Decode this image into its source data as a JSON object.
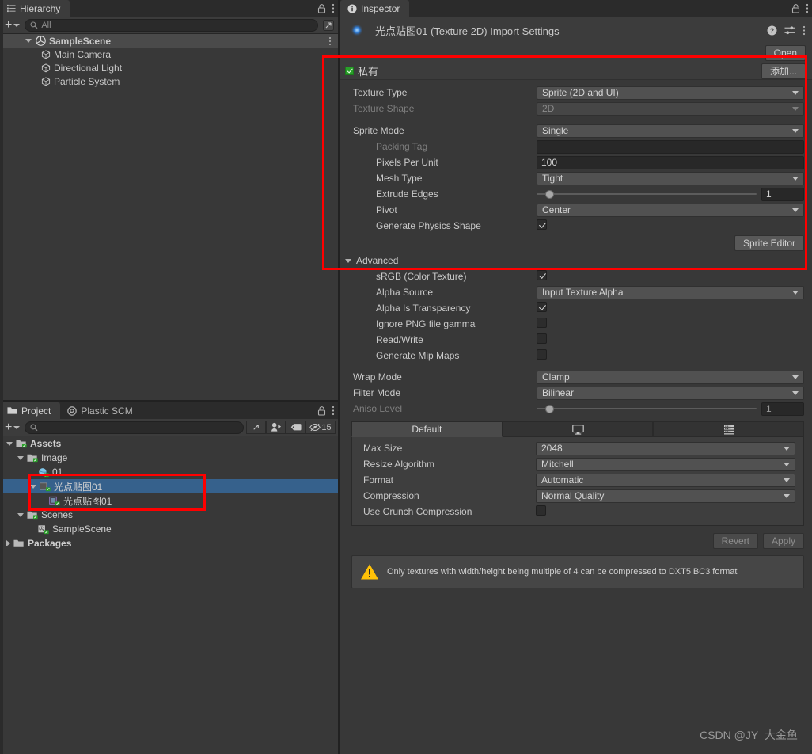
{
  "hierarchy": {
    "tab_label": "Hierarchy",
    "tab_icon": "hierarchy-icon",
    "lock_icon": "lock-icon",
    "menu_icon": "kebab-menu-icon",
    "add_label": "+",
    "search_placeholder": "All",
    "search_icon": "search-icon",
    "expand_icon": "expand-icon",
    "items": [
      {
        "label": "SampleScene",
        "depth": 0,
        "icon": "unity-scene-icon",
        "expanded": true,
        "has_menu": true
      },
      {
        "label": "Main Camera",
        "depth": 1,
        "icon": "gameobject-cube-icon",
        "expanded": null,
        "has_menu": false
      },
      {
        "label": "Directional Light",
        "depth": 1,
        "icon": "gameobject-cube-icon",
        "expanded": null,
        "has_menu": false
      },
      {
        "label": "Particle System",
        "depth": 1,
        "icon": "gameobject-cube-icon",
        "expanded": null,
        "has_menu": false
      }
    ]
  },
  "project": {
    "tabs": [
      {
        "label": "Project",
        "icon": "folder-icon",
        "active": true
      },
      {
        "label": "Plastic SCM",
        "icon": "plastic-scm-icon",
        "active": false
      }
    ],
    "lock_icon": "lock-icon",
    "menu_icon": "kebab-menu-icon",
    "add_label": "+",
    "search_placeholder": "",
    "search_icon": "search-icon",
    "tool_icons": [
      "expand-icon",
      "avatar-filter-icon",
      "label-tag-icon",
      "hidden-eye-icon"
    ],
    "visible_count": "15",
    "items": [
      {
        "label": "Assets",
        "depth": 0,
        "icon": "folder-assets-icon",
        "expanded": true,
        "bold": true,
        "selected": false
      },
      {
        "label": "Image",
        "depth": 1,
        "icon": "folder-assets-icon",
        "expanded": true,
        "bold": false,
        "selected": false
      },
      {
        "label": "01",
        "depth": 2,
        "icon": "sphere-asset-icon",
        "expanded": null,
        "bold": false,
        "selected": false
      },
      {
        "label": "光点贴图01",
        "depth": 2,
        "icon": "texture-asset-icon",
        "expanded": true,
        "bold": false,
        "selected": true
      },
      {
        "label": "光点贴图01",
        "depth": 3,
        "icon": "sprite-asset-icon",
        "expanded": null,
        "bold": false,
        "selected": false
      },
      {
        "label": "Scenes",
        "depth": 1,
        "icon": "folder-assets-icon",
        "expanded": true,
        "bold": false,
        "selected": false
      },
      {
        "label": "SampleScene",
        "depth": 2,
        "icon": "unity-scene-icon",
        "expanded": null,
        "bold": false,
        "selected": false
      },
      {
        "label": "Packages",
        "depth": 0,
        "icon": "folder-icon",
        "expanded": false,
        "bold": true,
        "selected": false
      }
    ]
  },
  "inspector": {
    "tab_label": "Inspector",
    "tab_icon": "info-icon",
    "lock_icon": "lock-icon",
    "menu_icon": "kebab-menu-icon",
    "asset_icon": "texture-preview-icon",
    "title": "光点贴图01 (Texture 2D) Import Settings",
    "head_icons": [
      "help-icon",
      "preset-icon",
      "kebab-menu-icon"
    ],
    "open_button": "Open",
    "private_row": {
      "checkbox_checked": true,
      "label": "私有",
      "add_button": "添加..."
    },
    "texture_settings": [
      {
        "name": "texture-type",
        "label": "Texture Type",
        "control": "dropdown",
        "value": "Sprite (2D and UI)",
        "indent": false,
        "dim": false
      },
      {
        "name": "texture-shape",
        "label": "Texture Shape",
        "control": "dropdown",
        "value": "2D",
        "indent": false,
        "dim": true
      },
      {
        "name": "sprite-mode",
        "label": "Sprite Mode",
        "control": "dropdown",
        "value": "Single",
        "indent": false,
        "dim": false,
        "gap_above": true
      },
      {
        "name": "packing-tag",
        "label": "Packing Tag",
        "control": "text",
        "value": "",
        "indent": true,
        "dim": true
      },
      {
        "name": "pixels-per-unit",
        "label": "Pixels Per Unit",
        "control": "text",
        "value": "100",
        "indent": true,
        "dim": false
      },
      {
        "name": "mesh-type",
        "label": "Mesh Type",
        "control": "dropdown",
        "value": "Tight",
        "indent": true,
        "dim": false
      },
      {
        "name": "extrude-edges",
        "label": "Extrude Edges",
        "control": "slider",
        "value": "1",
        "indent": true,
        "dim": false,
        "slider_pct": 4
      },
      {
        "name": "pivot",
        "label": "Pivot",
        "control": "dropdown",
        "value": "Center",
        "indent": true,
        "dim": false
      },
      {
        "name": "generate-physics-shape",
        "label": "Generate Physics Shape",
        "control": "checkbox",
        "value": true,
        "indent": true,
        "dim": false
      }
    ],
    "sprite_editor_button": "Sprite Editor",
    "advanced": {
      "label": "Advanced",
      "expanded": true,
      "settings": [
        {
          "name": "srgb-color-texture",
          "label": "sRGB (Color Texture)",
          "control": "checkbox",
          "value": true,
          "indent": true,
          "dim": false
        },
        {
          "name": "alpha-source",
          "label": "Alpha Source",
          "control": "dropdown",
          "value": "Input Texture Alpha",
          "indent": true,
          "dim": false
        },
        {
          "name": "alpha-is-transparency",
          "label": "Alpha Is Transparency",
          "control": "checkbox",
          "value": true,
          "indent": true,
          "dim": false
        },
        {
          "name": "ignore-png-file-gamma",
          "label": "Ignore PNG file gamma",
          "control": "checkbox",
          "value": false,
          "indent": true,
          "dim": false
        },
        {
          "name": "read-write",
          "label": "Read/Write",
          "control": "checkbox",
          "value": false,
          "indent": true,
          "dim": false
        },
        {
          "name": "generate-mip-maps",
          "label": "Generate Mip Maps",
          "control": "checkbox",
          "value": false,
          "indent": true,
          "dim": false
        }
      ]
    },
    "common_settings": [
      {
        "name": "wrap-mode",
        "label": "Wrap Mode",
        "control": "dropdown",
        "value": "Clamp",
        "indent": false,
        "dim": false
      },
      {
        "name": "filter-mode",
        "label": "Filter Mode",
        "control": "dropdown",
        "value": "Bilinear",
        "indent": false,
        "dim": false
      },
      {
        "name": "aniso-level",
        "label": "Aniso Level",
        "control": "slider",
        "value": "1",
        "indent": false,
        "dim": true,
        "slider_pct": 4
      }
    ],
    "platform_tabs": [
      {
        "label": "Default",
        "icon": "",
        "active": true
      },
      {
        "label": "",
        "icon": "standalone-monitor-icon",
        "active": false
      },
      {
        "label": "",
        "icon": "android-chip-icon",
        "active": false
      }
    ],
    "platform_settings": [
      {
        "name": "max-size",
        "label": "Max Size",
        "control": "dropdown",
        "value": "2048",
        "indent": false,
        "dim": false
      },
      {
        "name": "resize-algorithm",
        "label": "Resize Algorithm",
        "control": "dropdown",
        "value": "Mitchell",
        "indent": false,
        "dim": false
      },
      {
        "name": "format",
        "label": "Format",
        "control": "dropdown",
        "value": "Automatic",
        "indent": false,
        "dim": false
      },
      {
        "name": "compression",
        "label": "Compression",
        "control": "dropdown",
        "value": "Normal Quality",
        "indent": false,
        "dim": false
      },
      {
        "name": "use-crunch-compression",
        "label": "Use Crunch Compression",
        "control": "checkbox",
        "value": false,
        "indent": false,
        "dim": false
      }
    ],
    "revert_button": "Revert",
    "apply_button": "Apply",
    "warning": {
      "icon": "warning-triangle-icon",
      "text": "Only textures with width/height being multiple of 4 can be compressed to DXT5|BC3 format"
    }
  },
  "watermark": "CSDN @JY_大金鱼",
  "colors": {
    "panel_bg": "#383838",
    "header_bg": "#3c3c3c",
    "tabbar_bg": "#2b2b2b",
    "selection_blue": "#2c5d87",
    "annotation_red": "#ff0000",
    "warning_yellow": "#ffc107",
    "check_green": "#2aa02a"
  }
}
